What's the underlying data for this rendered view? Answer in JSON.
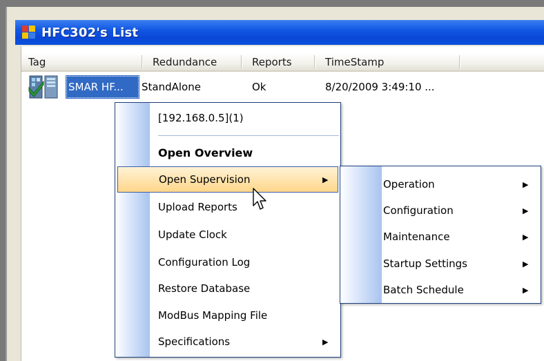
{
  "window": {
    "title": "HFC302's List"
  },
  "columns": [
    {
      "label": "Tag"
    },
    {
      "label": "Redundance"
    },
    {
      "label": "Reports"
    },
    {
      "label": "TimeStamp"
    }
  ],
  "rows": [
    {
      "tag": "SMAR HF...",
      "redundance": "StandAlone",
      "reports": "Ok",
      "timestamp": "8/20/2009 3:49:10 ...",
      "icon": "device-ok-icon",
      "selected": true
    }
  ],
  "context_menu": {
    "items": [
      {
        "label": "[192.168.0.5](1)",
        "type": "info"
      },
      {
        "label": "Open Overview",
        "type": "bold"
      },
      {
        "label": "Open Supervision",
        "type": "submenu",
        "highlighted": true
      },
      {
        "label": "Upload Reports",
        "type": "item"
      },
      {
        "label": "Update Clock",
        "type": "item"
      },
      {
        "label": "Configuration Log",
        "type": "item"
      },
      {
        "label": "Restore Database",
        "type": "item"
      },
      {
        "label": "ModBus Mapping File",
        "type": "item"
      },
      {
        "label": "Specifications",
        "type": "submenu"
      }
    ]
  },
  "submenu": {
    "items": [
      {
        "label": "Operation"
      },
      {
        "label": "Configuration"
      },
      {
        "label": "Maintenance"
      },
      {
        "label": "Startup Settings"
      },
      {
        "label": "Batch Schedule"
      }
    ]
  },
  "colors": {
    "titlebar": "#0a48d6",
    "selection": "#316ac5",
    "menu_border": "#1f3f7a",
    "menu_highlight": "#ffd68a"
  }
}
